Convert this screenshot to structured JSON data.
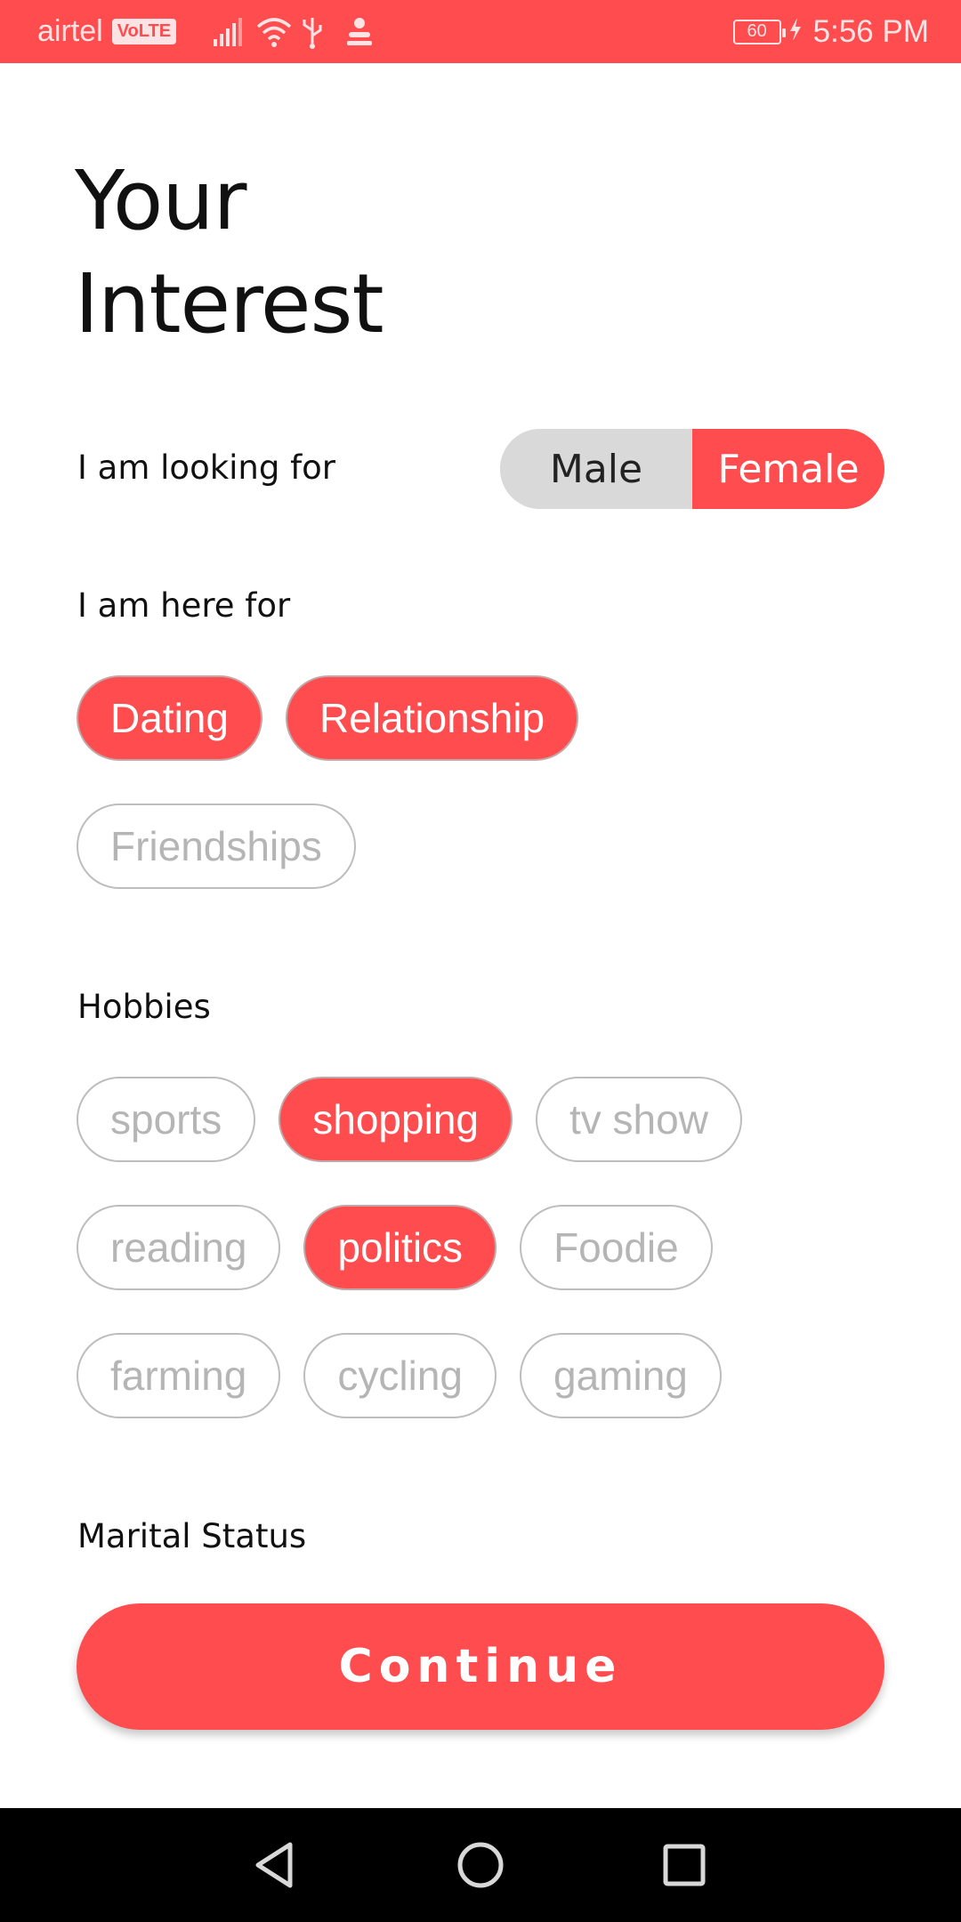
{
  "status_bar": {
    "carrier": "airtel",
    "volte": "VoLTE",
    "battery": "60",
    "time": "5:56 PM",
    "icons": [
      "signal-icon",
      "wifi-icon",
      "usb-icon",
      "app-notification-icon",
      "battery-icon",
      "charging-icon"
    ]
  },
  "page": {
    "title_line1": "Your",
    "title_line2": "Interest"
  },
  "looking_for": {
    "label": "I am looking for",
    "options": [
      "Male",
      "Female"
    ],
    "selected": "Female"
  },
  "here_for": {
    "label": "I am here for",
    "chips": [
      {
        "label": "Dating",
        "selected": true
      },
      {
        "label": "Relationship",
        "selected": true
      },
      {
        "label": "Friendships",
        "selected": false
      }
    ]
  },
  "hobbies": {
    "label": "Hobbies",
    "chips": [
      {
        "label": "sports",
        "selected": false
      },
      {
        "label": "shopping",
        "selected": true
      },
      {
        "label": "tv show",
        "selected": false
      },
      {
        "label": "reading",
        "selected": false
      },
      {
        "label": "politics",
        "selected": true
      },
      {
        "label": "Foodie",
        "selected": false
      },
      {
        "label": "farming",
        "selected": false
      },
      {
        "label": "cycling",
        "selected": false
      },
      {
        "label": "gaming",
        "selected": false
      }
    ]
  },
  "marital_status": {
    "label": "Marital Status"
  },
  "continue_label": "Continue",
  "colors": {
    "accent": "#ff4c4f",
    "chip_inactive_text": "#b5b5b5",
    "toggle_inactive": "#d9d9d9"
  },
  "nav_bar": {
    "icons": [
      "back-icon",
      "home-icon",
      "recents-icon"
    ]
  }
}
